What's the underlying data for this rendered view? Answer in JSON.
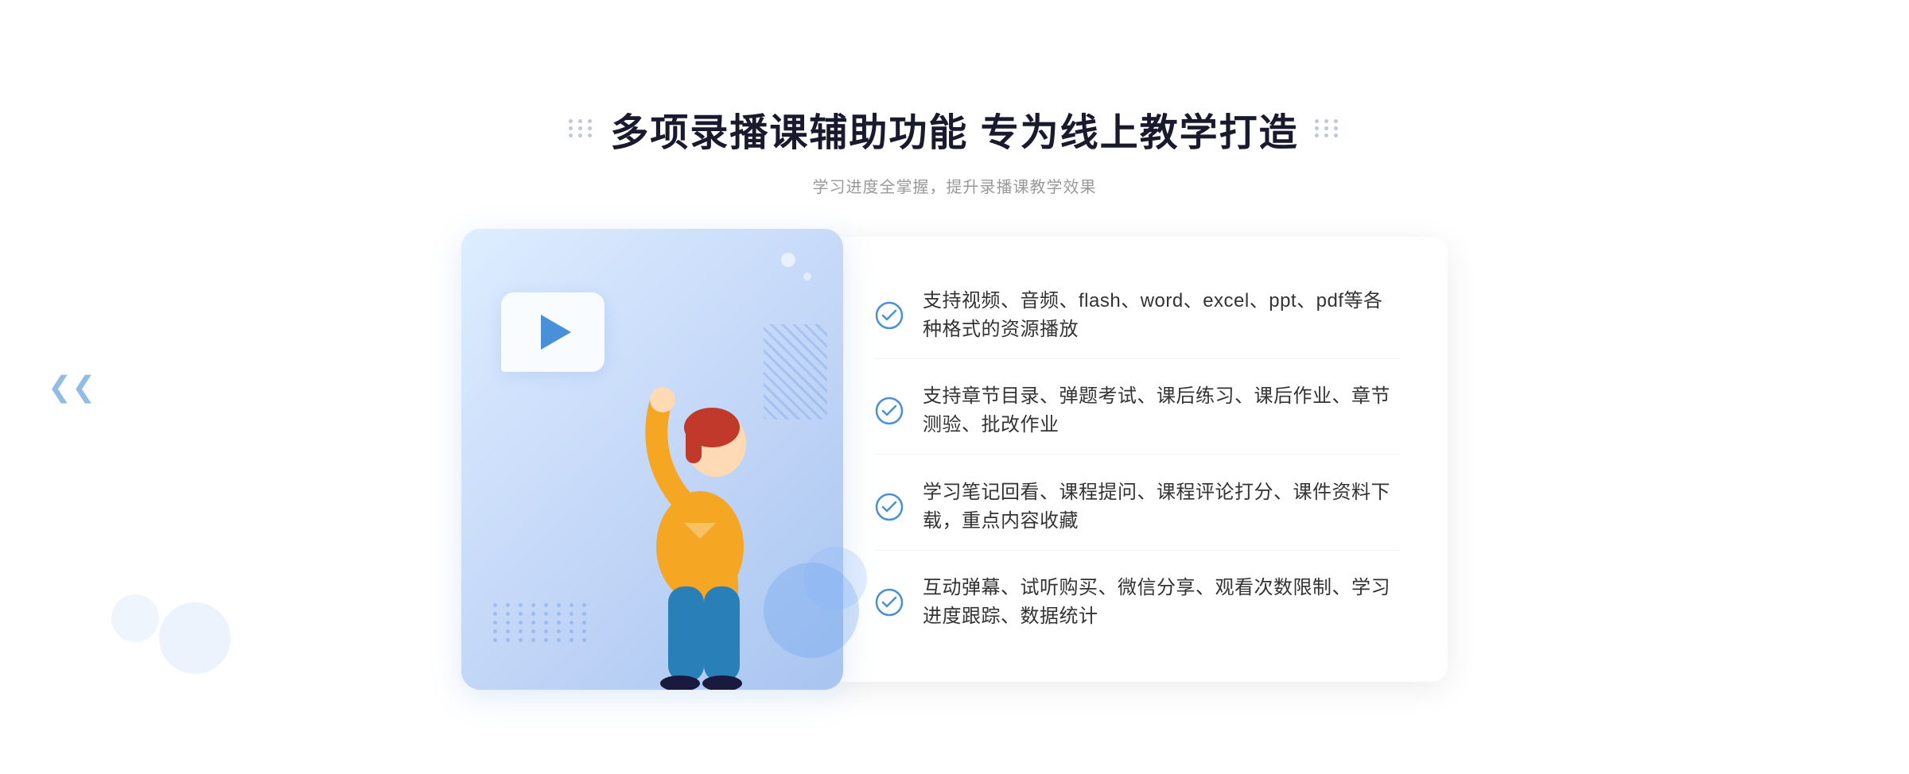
{
  "header": {
    "title": "多项录播课辅助功能 专为线上教学打造",
    "subtitle": "学习进度全掌握，提升录播课教学效果"
  },
  "features": [
    {
      "id": 1,
      "text": "支持视频、音频、flash、word、excel、ppt、pdf等各种格式的资源播放"
    },
    {
      "id": 2,
      "text": "支持章节目录、弹题考试、课后练习、课后作业、章节测验、批改作业"
    },
    {
      "id": 3,
      "text": "学习笔记回看、课程提问、课程评论打分、课件资料下载，重点内容收藏"
    },
    {
      "id": 4,
      "text": "互动弹幕、试听购买、微信分享、观看次数限制、学习进度跟踪、数据统计"
    }
  ],
  "colors": {
    "accent": "#3d7de8",
    "lightBlue": "#5b9ef9",
    "titleColor": "#1a1a2e",
    "subtitleColor": "#999999",
    "textColor": "#333333",
    "bgCard": "#ddeeff"
  },
  "icons": {
    "check": "check-circle",
    "play": "play",
    "leftArrow": "chevron-left"
  }
}
